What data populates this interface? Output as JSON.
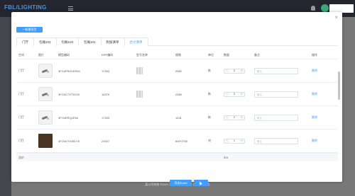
{
  "app": {
    "logo_text": "FBL/LIGHTING",
    "footer": "某公司系统 ©2021 Created by 文案 & 设计管理平台"
  },
  "modal": {
    "close": "×",
    "add_button": "+ 新增项目",
    "tabs": [
      {
        "label": "门厅"
      },
      {
        "label": "包厢102"
      },
      {
        "label": "包厢103"
      },
      {
        "label": "包厢101"
      },
      {
        "label": "附加清单"
      },
      {
        "label": "合计清单",
        "active": true
      }
    ],
    "columns": [
      "空间",
      "图片",
      "模型编码",
      "ERP编码",
      "型号名称",
      "规格",
      "单位",
      "数量",
      "备注",
      "操作"
    ],
    "rows": [
      {
        "space": "门厅",
        "code": "3FO4FROLER54",
        "erp": "17253",
        "spec": "2982",
        "unit": "栋",
        "qty": "3",
        "remark_placeholder": "备注",
        "action": "删除",
        "img": "lamp"
      },
      {
        "space": "门厅",
        "code": "3FO4C7XT3C0X",
        "erp": "16379",
        "spec": "2385",
        "unit": "栋",
        "qty": "2",
        "remark_placeholder": "备注",
        "action": "删除",
        "img": "lamp"
      },
      {
        "space": "门厅",
        "code": "3FO4ERQLE54",
        "erp": "17253",
        "spec": "1431",
        "unit": "栋",
        "qty": "2",
        "remark_placeholder": "备注",
        "action": "删除",
        "img": "lamp"
      },
      {
        "space": "门厅",
        "code": "3FO4GTX3ELY5",
        "erp": "21527",
        "spec": "600*2700",
        "unit": "块",
        "qty": "1",
        "remark_placeholder": "备注",
        "action": "删除",
        "img": "wood"
      }
    ],
    "stepper": {
      "minus": "−",
      "plus": "+"
    },
    "total": {
      "label": "总价",
      "value": "531"
    },
    "export_button": "导出Excel"
  }
}
